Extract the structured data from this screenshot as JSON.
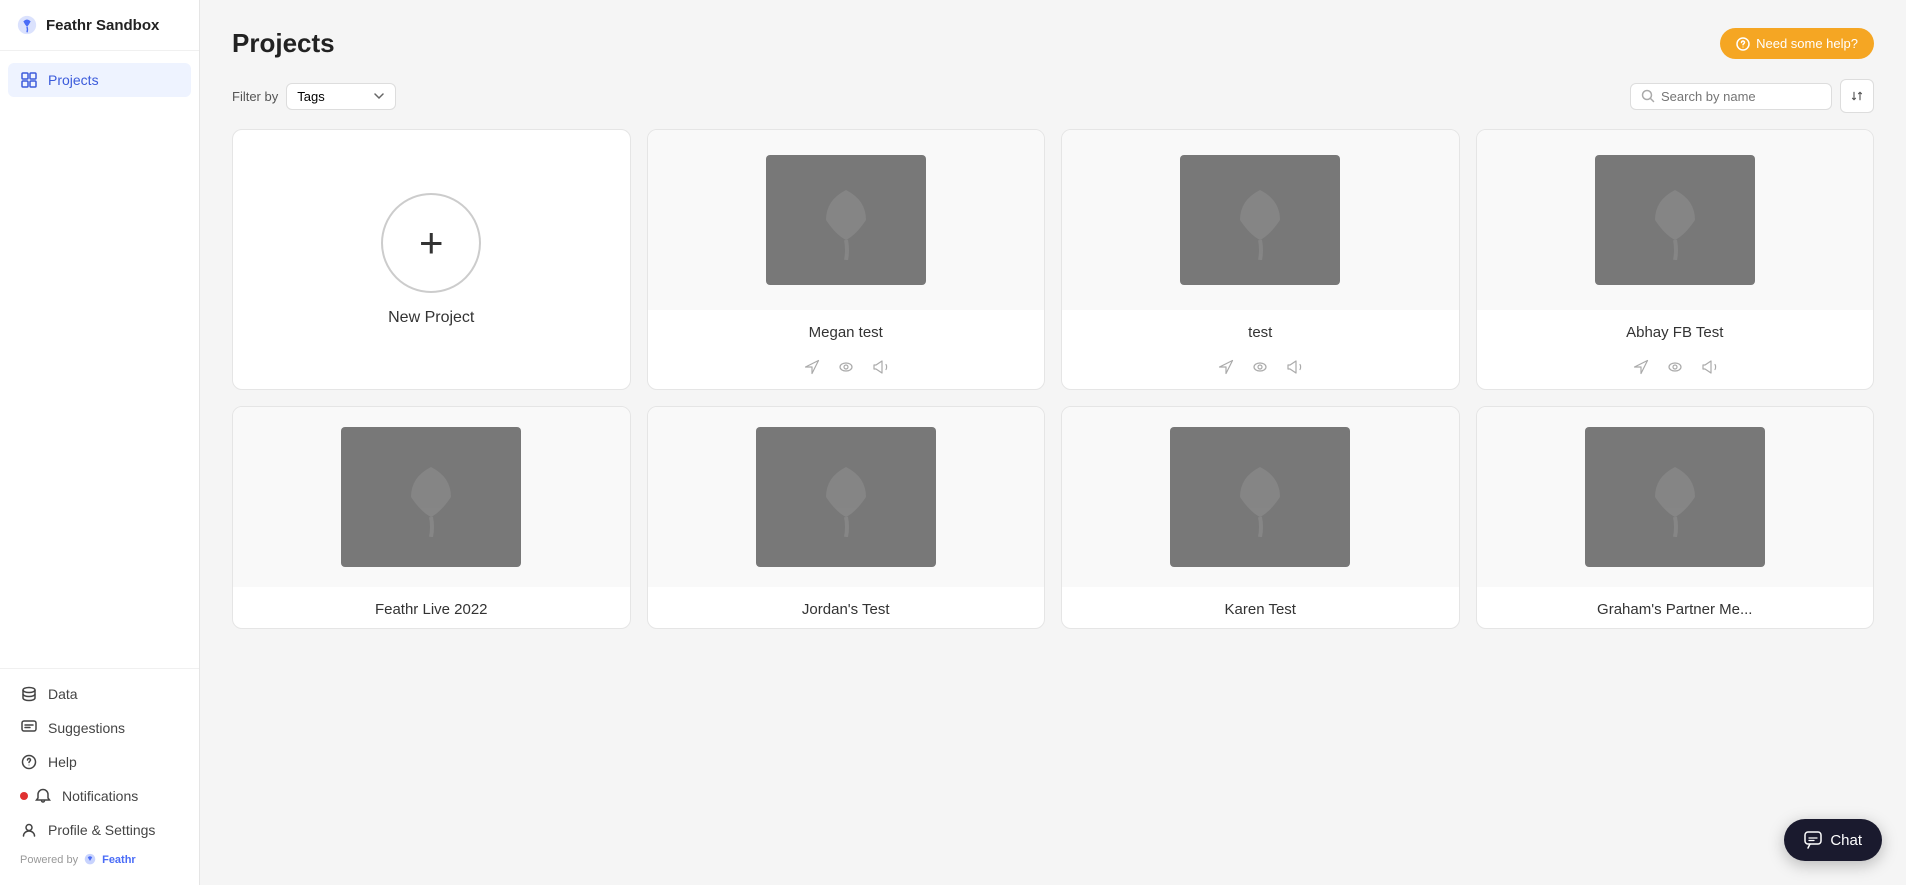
{
  "sidebar": {
    "workspace_name": "Feathr Sandbox",
    "nav_top": [
      {
        "id": "projects",
        "label": "Projects",
        "icon": "grid-icon",
        "active": true
      }
    ],
    "nav_bottom": [
      {
        "id": "data",
        "label": "Data",
        "icon": "database-icon"
      },
      {
        "id": "suggestions",
        "label": "Suggestions",
        "icon": "suggestions-icon"
      },
      {
        "id": "help",
        "label": "Help",
        "icon": "help-icon"
      },
      {
        "id": "notifications",
        "label": "Notifications",
        "icon": "bell-icon"
      },
      {
        "id": "profile",
        "label": "Profile & Settings",
        "icon": "profile-icon"
      }
    ],
    "powered_by": "Powered by",
    "powered_by_brand": "Feathr"
  },
  "header": {
    "title": "Projects",
    "help_button": "Need some help?"
  },
  "filter_bar": {
    "filter_label": "Filter by",
    "tags_placeholder": "Tags",
    "search_placeholder": "Search by name"
  },
  "projects": [
    {
      "id": "new",
      "type": "new",
      "label": "New Project"
    },
    {
      "id": "megan-test",
      "type": "project",
      "name": "Megan test",
      "has_thumbnail": true
    },
    {
      "id": "test",
      "type": "project",
      "name": "test",
      "has_thumbnail": true
    },
    {
      "id": "abhay-fb-test",
      "type": "project",
      "name": "Abhay FB Test",
      "has_thumbnail": true
    },
    {
      "id": "feathr-live-2022",
      "type": "project",
      "name": "Feathr Live 2022",
      "has_thumbnail": true
    },
    {
      "id": "jordans-test",
      "type": "project",
      "name": "Jordan's Test",
      "has_thumbnail": true
    },
    {
      "id": "karen-test",
      "type": "project",
      "name": "Karen Test",
      "has_thumbnail": true
    },
    {
      "id": "graham-partner",
      "type": "project",
      "name": "Graham's Partner Me...",
      "has_thumbnail": true
    }
  ],
  "chat": {
    "label": "Chat"
  }
}
